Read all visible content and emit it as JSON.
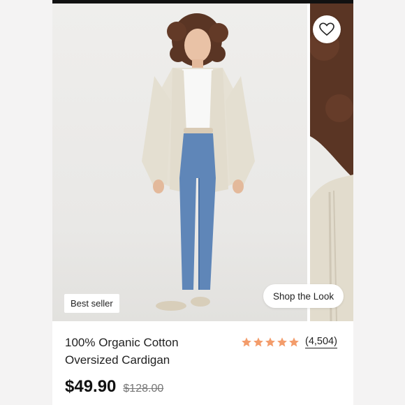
{
  "product": {
    "badge": "Best seller",
    "shop_the_look": "Shop the Look",
    "title_line1": "100% Organic Cotton",
    "title_line2": "Oversized Cardigan",
    "rating_count": "(4,504)",
    "rating_stars": 5,
    "price_current": "$49.90",
    "price_original": "$128.00"
  },
  "colors": {
    "star": "#f39c6b",
    "denim": "#5f86b8",
    "cardigan": "#e6e1d4"
  },
  "icons": {
    "favorite": "heart-outline-icon",
    "rating": "star-icon"
  }
}
